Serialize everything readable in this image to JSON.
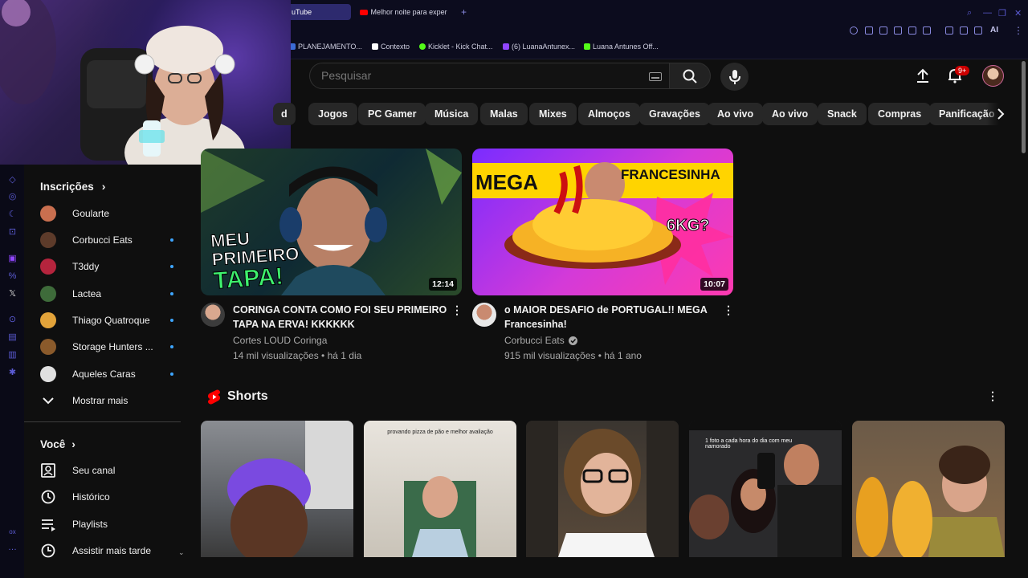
{
  "browser": {
    "tabs": [
      {
        "label": "uTube",
        "active": true
      },
      {
        "label": "Melhor noite para experime",
        "active": false
      }
    ],
    "new_tab": "+",
    "bookmarks": [
      {
        "label": "PLANEJAMENTO...",
        "color": "#3b6bd6"
      },
      {
        "label": "Contexto",
        "color": "#ffffff"
      },
      {
        "label": "Kicklet - Kick Chat...",
        "color": "#53fc18"
      },
      {
        "label": "(6) LuanaAntunex...",
        "color": "#9146ff"
      },
      {
        "label": "Luana Antunes Off...",
        "color": "#53fc18"
      }
    ],
    "toolbar_ai_label": "AI"
  },
  "youtube": {
    "search": {
      "placeholder": "Pesquisar"
    },
    "notifications_badge": "9+",
    "chips": [
      "d",
      "Jogos",
      "PC Gamer",
      "Música",
      "Malas",
      "Mixes",
      "Almoços",
      "Gravações",
      "Ao vivo",
      "Ao vivo",
      "Snack",
      "Compras",
      "Panificação"
    ],
    "sidebar": {
      "subscriptions_title": "Inscrições",
      "subscriptions": [
        {
          "name": "Goularte",
          "has_new": false,
          "color": "#c96f4f"
        },
        {
          "name": "Corbucci Eats",
          "has_new": true,
          "color": "#5d3b2a"
        },
        {
          "name": "T3ddy",
          "has_new": true,
          "color": "#b5243d"
        },
        {
          "name": "Lactea",
          "has_new": true,
          "color": "#3e6b3a"
        },
        {
          "name": "Thiago Quatroque",
          "has_new": true,
          "color": "#e2a33a"
        },
        {
          "name": "Storage Hunters ...",
          "has_new": true,
          "color": "#8a5a2b"
        },
        {
          "name": "Aqueles Caras",
          "has_new": true,
          "color": "#e0e0e0"
        }
      ],
      "show_more": "Mostrar mais",
      "you_title": "Você",
      "you_items": [
        "Seu canal",
        "Histórico",
        "Playlists",
        "Assistir mais tarde"
      ]
    },
    "videos": [
      {
        "title_line1": "CORINGA CONTA COMO FOI SEU PRIMEIRO",
        "title_line2": "TAPA NA ERVA! KKKKKK",
        "channel": "Cortes LOUD Coringa",
        "verified": false,
        "meta": "14 mil visualizações • há 1 dia",
        "duration": "12:14",
        "thumb_text": [
          "MEU",
          "PRIMEIRO",
          "TAPA!"
        ]
      },
      {
        "title_line1": "o MAIOR DESAFIO de PORTUGAL!! MEGA",
        "title_line2": "Francesinha!",
        "channel": "Corbucci Eats",
        "verified": true,
        "meta": "915 mil visualizações • há 1 ano",
        "duration": "10:07",
        "thumb_text": [
          "MEGA",
          "FRANCESINHA",
          "6KG?"
        ]
      }
    ],
    "shorts_title": "Shorts",
    "shorts": [
      {
        "caption": "",
        "color": "#6b6e73"
      },
      {
        "caption": "provando pizza de pão e melhor avaliação",
        "color": "#d9d6cf"
      },
      {
        "caption": "",
        "color": "#3a3530"
      },
      {
        "caption": "1 foto a cada hora do dia com meu namorado",
        "color": "#2a2a2c"
      },
      {
        "caption": "",
        "color": "#7a5a3a"
      }
    ],
    "colors": {
      "accent": "#ff0000",
      "link_blue": "#3ea6ff"
    }
  }
}
